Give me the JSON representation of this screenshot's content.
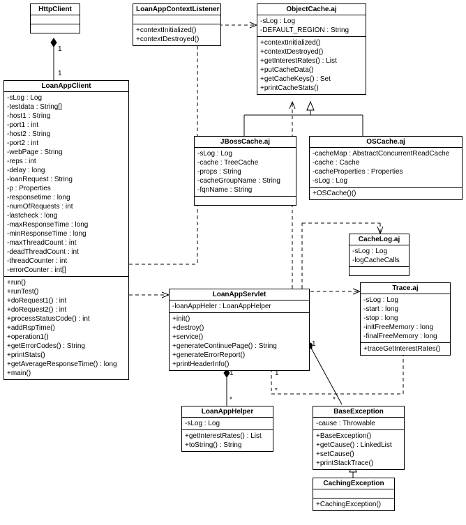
{
  "HttpClient": {
    "name": "HttpClient"
  },
  "LoanAppContextListener": {
    "name": "LoanAppContextListener",
    "ops": [
      "+contextInitialized()",
      "+contextDestroyed()"
    ]
  },
  "ObjectCache": {
    "name": "ObjectCache.aj",
    "attrs": [
      "-sLog : Log",
      "-DEFAULT_REGION : String"
    ],
    "ops": [
      "+contextInitialized()",
      "+contextDestroyed()",
      "+getInterestRates() : List",
      "+putCacheData()",
      "+getCacheKeys() : Set",
      "+printCacheStats()"
    ]
  },
  "LoanAppClient": {
    "name": "LoanAppClient",
    "attrs": [
      "-sLog : Log",
      "-testdata : String[]",
      "-host1 : String",
      "-port1 : int",
      "-host2 : String",
      "-port2 : int",
      "-webPage : String",
      "-reps : int",
      "-delay : long",
      "-loanRequest : String",
      "-p : Properties",
      "-responsetime : long",
      "-numOfRequests : int",
      "-lastcheck : long",
      "-maxResponseTime : long",
      "-minResponseTime : long",
      "-maxThreadCount : int",
      "-deadThreadCount : int",
      "-threadCounter : int",
      "-errorCounter : int[]"
    ],
    "ops": [
      "+run()",
      "+runTest()",
      "+doRequest1() : int",
      "+doRequest2() : int",
      "+processStatusCode() : int",
      "+addRspTime()",
      "+operation1()",
      "+getErrorCodes() : String",
      "+printStats()",
      "+getAverageResponseTime() : long",
      "+main()"
    ]
  },
  "JBossCache": {
    "name": "JBossCache.aj",
    "attrs": [
      "-sLog : Log",
      "-cache : TreeCache",
      "-props : String",
      "-cacheGroupName : String",
      "-fqnName : String"
    ]
  },
  "OSCache": {
    "name": "OSCache.aj",
    "attrs": [
      "-cacheMap : AbstractConcurrentReadCache",
      "-cache : Cache",
      "-cacheProperties : Properties",
      "-sLog : Log"
    ],
    "ops": [
      "+OSCache()()"
    ]
  },
  "CacheLog": {
    "name": "CacheLog.aj",
    "attrs": [
      "-sLog : Log",
      "-logCacheCalls"
    ]
  },
  "LoanAppServlet": {
    "name": "LoanAppServlet",
    "attrs": [
      "-loanAppHeler : LoanAppHelper"
    ],
    "ops": [
      "+init()",
      "+destroy()",
      "+service()",
      "+generateContinuePage() : String",
      "+generateErrorReport()",
      "+printHeaderInfo()"
    ]
  },
  "Trace": {
    "name": "Trace.aj",
    "attrs": [
      "-sLog : Log",
      "-start : long",
      "-stop : long",
      "-initFreeMemory : long",
      "-finalFreeMemory : long"
    ],
    "ops": [
      "+traceGetInterestRates()"
    ]
  },
  "LoanAppHelper": {
    "name": "LoanAppHelper",
    "attrs": [
      "-sLog : Log"
    ],
    "ops": [
      "+getInterestRates() : List",
      "+toString() : String"
    ]
  },
  "BaseException": {
    "name": "BaseException",
    "attrs": [
      "-cause : Throwable"
    ],
    "ops": [
      "+BaseException()",
      "+getCause() : LinkedList",
      "+setCause()",
      "+printStackTrace()"
    ]
  },
  "CachingException": {
    "name": "CachingException",
    "ops": [
      "+CachingException()"
    ]
  },
  "mult": {
    "m1": "1",
    "m2": "1",
    "m3": "1",
    "m4": "*",
    "m5": "1",
    "m6": "*",
    "m7": "1",
    "m8": "*"
  }
}
